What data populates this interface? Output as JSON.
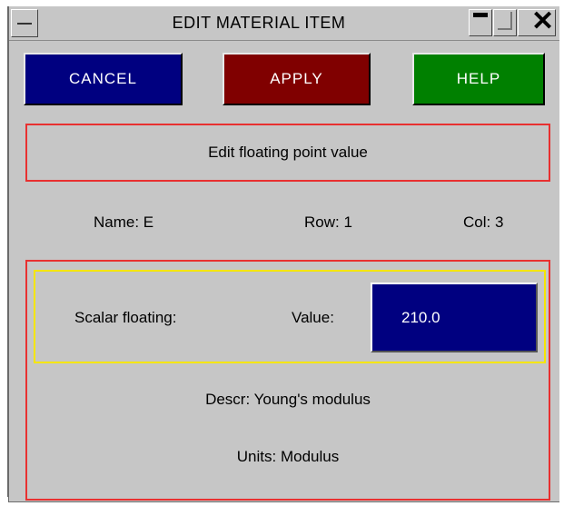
{
  "window": {
    "title": "EDIT MATERIAL ITEM",
    "controls": {
      "minimize": "minimize-icon",
      "maximize": "maximize-icon",
      "close": "close-icon"
    }
  },
  "toolbar": {
    "cancel_label": "CANCEL",
    "apply_label": "APPLY",
    "help_label": "HELP"
  },
  "header": {
    "text": "Edit floating point value"
  },
  "info": {
    "name": "Name: E",
    "row": "Row: 1",
    "col": "Col: 3"
  },
  "editor": {
    "type_label": "Scalar floating:",
    "value_label": "Value:",
    "value": "210.0",
    "descr": "Descr: Young's modulus",
    "units": "Units: Modulus"
  },
  "colors": {
    "cancel": "#000080",
    "apply": "#800000",
    "help": "#008000",
    "frame_border": "#e83030",
    "highlight_border": "#f5e600",
    "background": "#c6c6c6"
  }
}
